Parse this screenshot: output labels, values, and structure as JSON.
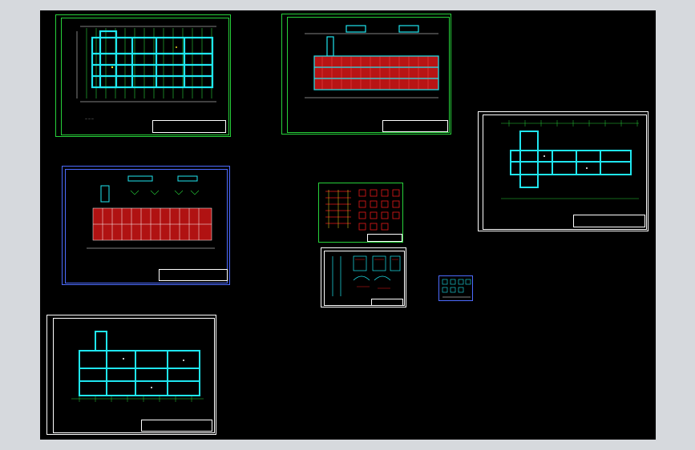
{
  "viewer": {
    "background": "#d6d9dd",
    "canvas_color": "#000000",
    "colors": {
      "cyan": "#1fe6f0",
      "green": "#27d13a",
      "red": "#e81818",
      "white": "#ffffff",
      "blue": "#4d6bff",
      "yellow": "#f0e020"
    }
  },
  "sheets": [
    {
      "id": "plan-1",
      "kind": "cyan-floor-plan"
    },
    {
      "id": "plan-2",
      "kind": "red-rebar-plan"
    },
    {
      "id": "plan-3",
      "kind": "red-column-plan"
    },
    {
      "id": "plan-4",
      "kind": "cyan-floor-plan"
    },
    {
      "id": "plan-5",
      "kind": "cyan-floor-plan"
    },
    {
      "id": "detail-1",
      "kind": "detail-sheet"
    },
    {
      "id": "detail-2",
      "kind": "detail-sheet"
    },
    {
      "id": "detail-3",
      "kind": "small-detail"
    }
  ]
}
